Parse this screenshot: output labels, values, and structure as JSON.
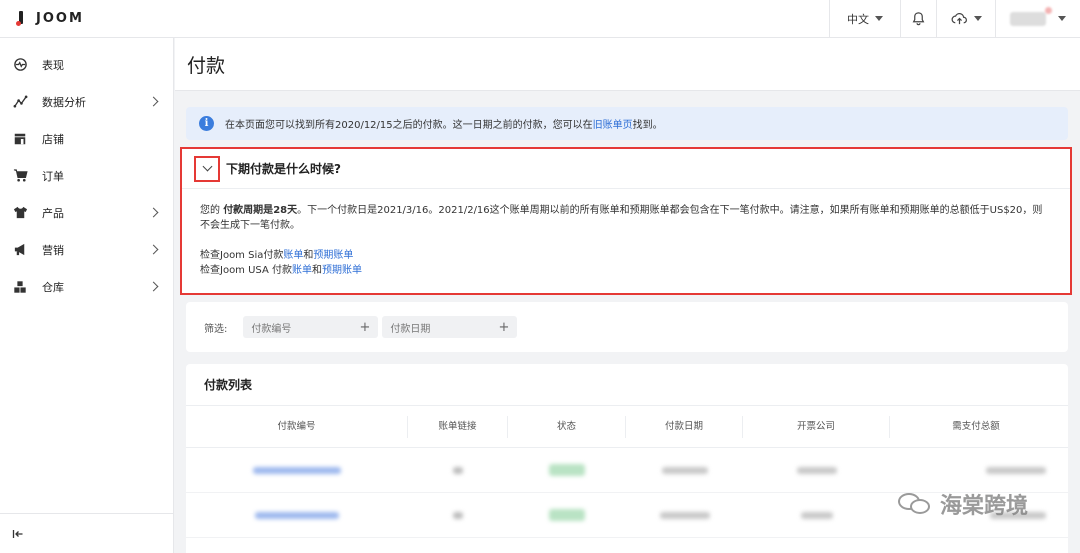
{
  "brand": {
    "name": "JOOM"
  },
  "topbar": {
    "language": "中文"
  },
  "sidebar": {
    "items": [
      {
        "label": "表现",
        "icon": "dashboard-icon",
        "has_submenu": false
      },
      {
        "label": "数据分析",
        "icon": "analytics-icon",
        "has_submenu": true
      },
      {
        "label": "店铺",
        "icon": "store-icon",
        "has_submenu": false
      },
      {
        "label": "订单",
        "icon": "cart-icon",
        "has_submenu": false
      },
      {
        "label": "产品",
        "icon": "shirt-icon",
        "has_submenu": true
      },
      {
        "label": "营销",
        "icon": "megaphone-icon",
        "has_submenu": true
      },
      {
        "label": "仓库",
        "icon": "warehouse-icon",
        "has_submenu": true
      }
    ],
    "collapse_icon": "collapse-icon"
  },
  "page": {
    "title": "付款"
  },
  "banner": {
    "text_before": "在本页面您可以找到所有2020/12/15之后的付款。这一日期之前的付款，您可以在",
    "link": "旧账单页",
    "text_after": "找到。"
  },
  "faq": {
    "title": "下期付款是什么时候?",
    "p1_prefix": "您的 ",
    "p1_bold1": "付款周期是",
    "p1_bold2": "28天",
    "p1_rest": "。下一个付款日是2021/3/16。2021/2/16这个账单周期以前的所有账单和预期账单都会包含在下一笔付款中。请注意，如果所有账单和预期账单的总额低于US$20，则不会生成下一笔付款。",
    "line1_prefix": "检查Joom Sia付款",
    "line2_prefix": "检查Joom USA 付款",
    "link_bills": "账单",
    "and": "和",
    "link_expected": "预期账单"
  },
  "filter": {
    "label": "筛选:",
    "chips": [
      "付款编号",
      "付款日期"
    ]
  },
  "table": {
    "title": "付款列表",
    "columns": [
      "付款编号",
      "账单链接",
      "状态",
      "付款日期",
      "开票公司",
      "需支付总额"
    ]
  },
  "watermark": {
    "text": "海棠跨境"
  },
  "colors": {
    "accent": "#2f6fd6",
    "highlight": "#e53935",
    "banner_bg": "#e6eefb",
    "status_green": "#3cb371"
  }
}
